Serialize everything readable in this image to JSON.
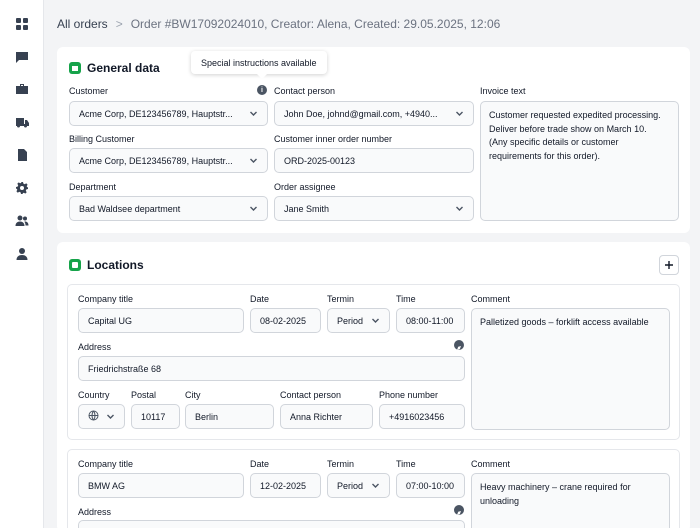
{
  "sidebar": {
    "items": [
      {
        "icon": "dashboard-icon"
      },
      {
        "icon": "messages-icon"
      },
      {
        "icon": "briefcase-icon"
      },
      {
        "icon": "truck-icon"
      },
      {
        "icon": "document-icon"
      },
      {
        "icon": "settings-icon"
      },
      {
        "icon": "team-icon"
      },
      {
        "icon": "user-icon"
      }
    ]
  },
  "breadcrumb": {
    "root": "All orders",
    "current": "Order #BW17092024010, Creator: Alena, Created: 29.05.2025, 12:06"
  },
  "general": {
    "title": "General data",
    "tooltip": "Special instructions available",
    "customer_label": "Customer",
    "customer_value": "Acme Corp, DE123456789, Hauptstr...",
    "contact_label": "Contact person",
    "contact_value": "John Doe, johnd@gmail.com, +4940...",
    "invoice_label": "Invoice text",
    "invoice_value": "Customer requested expedited processing. Deliver before trade show on March 10.\n(Any specific details or customer requirements for this order).",
    "billing_label": "Billing Customer",
    "billing_value": "Acme Corp, DE123456789, Hauptstr...",
    "inner_order_label": "Customer inner order number",
    "inner_order_value": "ORD-2025-00123",
    "department_label": "Department",
    "department_value": "Bad Waldsee department",
    "assignee_label": "Order assignee",
    "assignee_value": "Jane Smith"
  },
  "locations": {
    "title": "Locations",
    "labels": {
      "company": "Company title",
      "date": "Date",
      "termin": "Termin",
      "time": "Time",
      "comment": "Comment",
      "address": "Address",
      "country": "Country",
      "postal": "Postal",
      "city": "City",
      "contact": "Contact person",
      "phone": "Phone number"
    },
    "items": [
      {
        "company": "Capital UG",
        "date": "08-02-2025",
        "termin": "Period",
        "time": "08:00-11:00",
        "comment": "Palletized goods – forklift access available",
        "address": "Friedrichstraße 68",
        "postal": "10117",
        "city": "Berlin",
        "contact": "Anna Richter",
        "phone": "+4916023456"
      },
      {
        "company": "BMW AG",
        "date": "12-02-2025",
        "termin": "Period",
        "time": "07:00-10:00",
        "comment": "Heavy machinery – crane required for unloading"
      }
    ]
  },
  "colors": {
    "accent": "#16a34a",
    "background": "#f3f4f6",
    "field_bg": "#f9fafb"
  }
}
